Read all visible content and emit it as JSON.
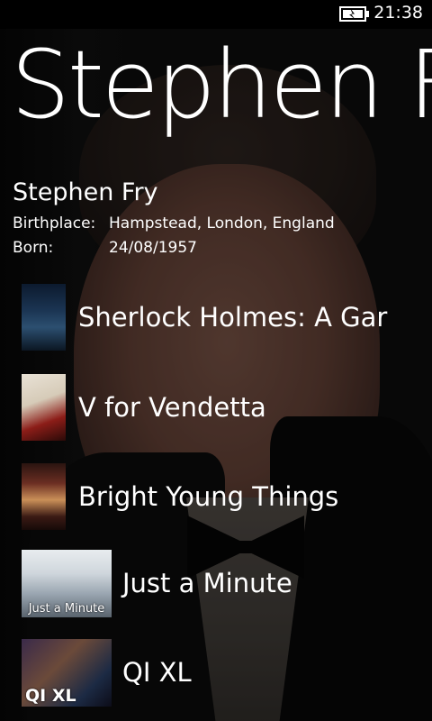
{
  "status_bar": {
    "time": "21:38",
    "battery_icon": "battery-charging-icon"
  },
  "panorama": {
    "title": "Stephen Fry"
  },
  "details": {
    "name": "Stephen Fry",
    "birthplace_label": "Birthplace:",
    "birthplace_value": "Hampstead, London, England",
    "born_label": "Born:",
    "born_value": "24/08/1957"
  },
  "filmography": [
    {
      "title": "Sherlock Holmes: A Gar",
      "thumb": "poster"
    },
    {
      "title": "V for Vendetta",
      "thumb": "poster"
    },
    {
      "title": "Bright Young Things",
      "thumb": "poster"
    },
    {
      "title": "Just a Minute",
      "thumb": "square",
      "thumb_caption": "Just a Minute"
    },
    {
      "title": "QI XL",
      "thumb": "square",
      "thumb_caption": "QI XL"
    }
  ],
  "colors": {
    "background": "#000000",
    "text": "#ffffff"
  }
}
